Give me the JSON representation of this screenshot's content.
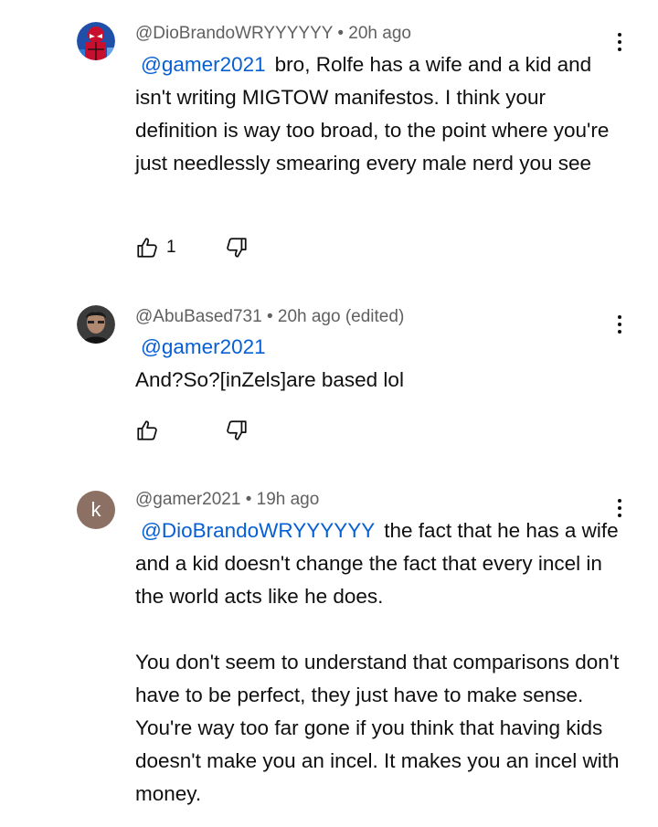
{
  "comments": [
    {
      "author": "@DioBrandoWRYYYYYY",
      "separator": "•",
      "time": "20h ago",
      "mention": "@gamer2021",
      "paragraphs": [
        "bro, Rolfe has a wife and a kid and isn't writing MIGTOW manifestos. I think your definition is way too broad, to the point where you're just needlessly smearing every male nerd you see"
      ],
      "likes": "1",
      "avatar_letter": "",
      "avatar_color": "#1f4fa8"
    },
    {
      "author": "@AbuBased731",
      "separator": "•",
      "time": "20h ago (edited)",
      "mention": "@gamer2021",
      "paragraphs": [
        "And?So?[inZels]are based lol"
      ],
      "likes": "",
      "avatar_letter": "",
      "avatar_color": "#3b3b3b"
    },
    {
      "author": "@gamer2021",
      "separator": "•",
      "time": "19h ago",
      "mention": "@DioBrandoWRYYYYYY",
      "paragraphs": [
        "the fact that he has a wife and a kid doesn't change the fact that every incel in the world acts like he does.",
        "You don't seem to understand that comparisons don't have to be perfect, they just have to make sense. You're way too far gone if you think that having kids doesn't make you an incel. It makes you an incel with money."
      ],
      "likes": "",
      "avatar_letter": "k",
      "avatar_color": "#8d7064"
    }
  ],
  "icons": {
    "like": "thumb-up-outline-icon",
    "dislike": "thumb-down-outline-icon",
    "menu": "more-vertical-icon"
  },
  "colors": {
    "mention": "#065fd4",
    "meta": "#606060",
    "text": "#0f0f0f"
  }
}
